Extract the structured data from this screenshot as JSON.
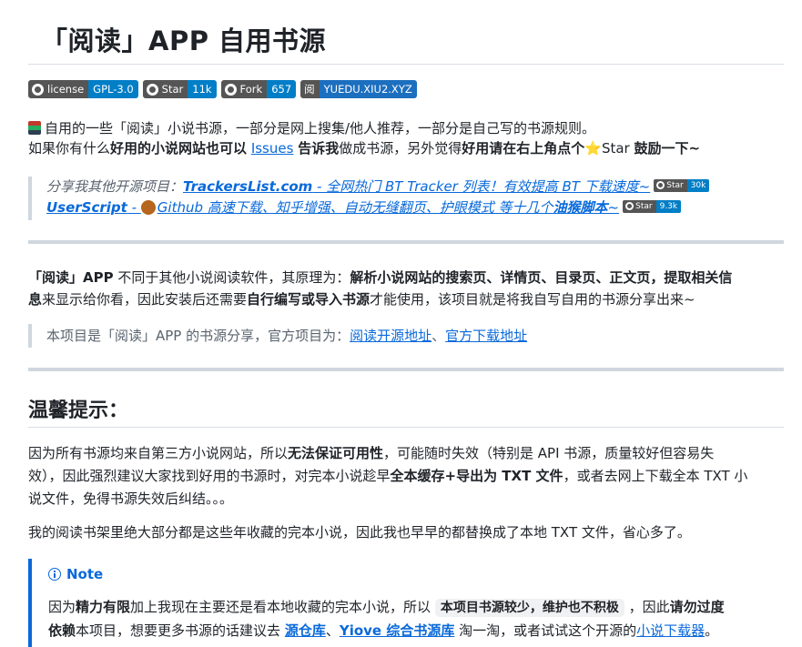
{
  "title": "「阅读」APP 自用书源",
  "badges": [
    {
      "label": "license",
      "value": "GPL-3.0",
      "color": "#007ec6"
    },
    {
      "label": "Star",
      "value": "11k",
      "color": "#007ec6"
    },
    {
      "label": "Fork",
      "value": "657",
      "color": "#007ec6"
    },
    {
      "label": "阅",
      "value": "YUEDU.XIU2.XYZ",
      "color": "#1c6fbf"
    }
  ],
  "intro": {
    "l1": "自用的一些「阅读」小说书源，一部分是网上搜集/他人推荐，一部分是自己写的书源规则。",
    "l2a": "如果你有什么",
    "l2b": "好用的小说网站也可以",
    "l2link": "Issues",
    "l2c": "告诉我",
    "l2d": "做成书源，另外觉得",
    "l2e": "好用请在右上角点个",
    "l2star": "⭐",
    "l2f": "Star",
    "l2g": "鼓励一下~"
  },
  "share": {
    "l1a": "分享我其他开源项目：",
    "l1link": "TrackersList.com",
    "l1b": " - 全网热门 BT Tracker 列表！有效提高 BT 下载速度~",
    "l1badge": {
      "label": "Star",
      "value": "30k"
    },
    "l2link": "UserScript",
    "l2a": " - ",
    "l2b": "Github 高速下载、知乎增强、自动无缝翻页、护眼模式 等十几个",
    "l2bold": "油猴脚本",
    "l2c": "~",
    "l2badge": {
      "label": "Star",
      "value": "9.3k"
    }
  },
  "about": {
    "l1a": "「阅读」APP",
    "l1b": " 不同于其他小说阅读软件，其原理为：",
    "l1c": "解析小说网站的搜索页、详情页、目录页、正文页，提取相关信",
    "l2a": "息",
    "l2b": "来显示给你看，因此安装后还需要",
    "l2c": "自行编写或导入书源",
    "l2d": "才能使用，该项目就是将我自写自用的书源分享出来~"
  },
  "official": {
    "text": "本项目是「阅读」APP 的书源分享，官方项目为：",
    "link1": "阅读开源地址",
    "sep": "、",
    "link2": "官方下载地址"
  },
  "tips": {
    "heading": "温馨提示：",
    "p1a": "因为所有书源均来自第三方小说网站，所以",
    "p1b": "无法保证可用性",
    "p1c": "，可能随时失效（特别是 API 书源，质量较好但容易失",
    "p1d": "效），因此强烈建议大家找到好用的书源时，对完本小说趁早",
    "p1e": "全本缓存+导出为 TXT 文件",
    "p1f": "，或者去网上下载全本 TXT 小",
    "p1g": "说文件，免得书源失效后纠结。。。",
    "p2": "我的阅读书架里绝大部分都是这些年收藏的完本小说，因此我也早早的都替换成了本地 TXT 文件，省心多了。"
  },
  "note": {
    "title": "Note",
    "l1a": "因为",
    "l1b": "精力有限",
    "l1c": "加上我现在主要还是看本地收藏的完本小说，所以",
    "l1code": "本项目书源较少，维护也不积极",
    "l1d": "，因此",
    "l1e": "请勿过度",
    "l2a": "依赖",
    "l2b": "本项目，想要更多书源的话建议去",
    "l2link1": "源仓库",
    "l2sep": "、",
    "l2link2": "Yiove 综合书源库",
    "l2c": "淘一淘，或者试试这个开源的",
    "l2link3": "小说下载器",
    "l2d": "。"
  }
}
